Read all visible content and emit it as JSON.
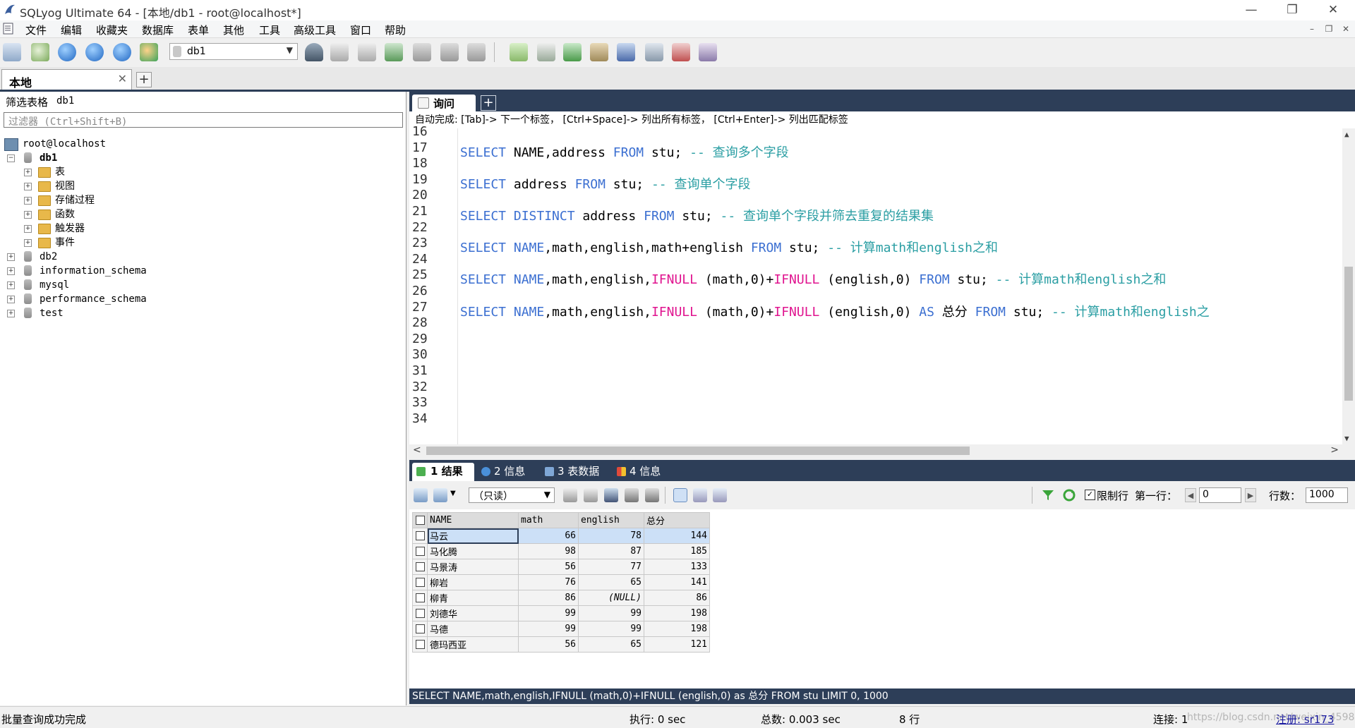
{
  "window": {
    "title": "SQLyog Ultimate 64 - [本地/db1 - root@localhost*]",
    "minimize": "—",
    "restore": "❐",
    "close": "✕"
  },
  "menu": {
    "items": [
      "文件",
      "编辑",
      "收藏夹",
      "数据库",
      "表单",
      "其他",
      "工具",
      "高级工具",
      "窗口",
      "帮助"
    ],
    "mdi_min": "–",
    "mdi_restore": "❐",
    "mdi_close": "✕"
  },
  "toolbar": {
    "db_select": "db1"
  },
  "connection_tab": {
    "label": "本地",
    "close": "✕",
    "add": "+"
  },
  "object_browser": {
    "filter_label": "筛选表格",
    "filter_db": "db1",
    "filter_placeholder": "过滤器 (Ctrl+Shift+B)",
    "server": "root@localhost",
    "db1": "db1",
    "db1_children": [
      "表",
      "视图",
      "存储过程",
      "函数",
      "触发器",
      "事件"
    ],
    "other_dbs": [
      "db2",
      "information_schema",
      "mysql",
      "performance_schema",
      "test"
    ]
  },
  "query_tab": {
    "label": "询问",
    "add": "+"
  },
  "autocomplete": "自动完成:  [Tab]-> 下一个标签， [Ctrl+Space]-> 列出所有标签， [Ctrl+Enter]-> 列出匹配标签",
  "editor": {
    "line_numbers": [
      "16",
      "17",
      "18",
      "19",
      "20",
      "21",
      "22",
      "23",
      "24",
      "25",
      "26",
      "27",
      "28",
      "29",
      "30",
      "31",
      "32",
      "33",
      "34"
    ],
    "lines": [
      [
        [
          "kw",
          "SELECT"
        ],
        [
          "t",
          " NAME"
        ],
        [
          "t",
          ",address "
        ],
        [
          "kw",
          "FROM"
        ],
        [
          "t",
          " stu; "
        ],
        [
          "cm",
          "-- 查询多个字段"
        ]
      ],
      [
        [
          "kw",
          "SELECT"
        ],
        [
          "t",
          " address "
        ],
        [
          "kw",
          "FROM"
        ],
        [
          "t",
          " stu; "
        ],
        [
          "cm",
          "-- 查询单个字段"
        ]
      ],
      [
        [
          "kw",
          "SELECT"
        ],
        [
          "t",
          " "
        ],
        [
          "kw",
          "DISTINCT"
        ],
        [
          "t",
          " address "
        ],
        [
          "kw",
          "FROM"
        ],
        [
          "t",
          " stu; "
        ],
        [
          "cm",
          "-- 查询单个字段并筛去重复的结果集"
        ]
      ],
      [
        [
          "kw",
          "SELECT"
        ],
        [
          "t",
          " "
        ],
        [
          "kw",
          "NAME"
        ],
        [
          "t",
          ",math,english,math+english "
        ],
        [
          "kw",
          "FROM"
        ],
        [
          "t",
          " stu; "
        ],
        [
          "cm",
          "-- 计算math和english之和"
        ]
      ],
      [
        [
          "kw",
          "SELECT"
        ],
        [
          "t",
          " "
        ],
        [
          "kw",
          "NAME"
        ],
        [
          "t",
          ",math,english,"
        ],
        [
          "fn",
          "IFNULL"
        ],
        [
          "t",
          " (math,0)+"
        ],
        [
          "fn",
          "IFNULL"
        ],
        [
          "t",
          " (english,0) "
        ],
        [
          "kw",
          "FROM"
        ],
        [
          "t",
          " stu; "
        ],
        [
          "cm",
          "-- 计算math和english之和"
        ]
      ],
      [
        [
          "kw",
          "SELECT"
        ],
        [
          "t",
          " "
        ],
        [
          "kw",
          "NAME"
        ],
        [
          "t",
          ",math,english,"
        ],
        [
          "fn",
          "IFNULL"
        ],
        [
          "t",
          " (math,0)+"
        ],
        [
          "fn",
          "IFNULL"
        ],
        [
          "t",
          " (english,0) "
        ],
        [
          "kw",
          "AS"
        ],
        [
          "t",
          " 总分 "
        ],
        [
          "kw",
          "FROM"
        ],
        [
          "t",
          " stu; "
        ],
        [
          "cm",
          "-- 计算math和english之"
        ]
      ]
    ]
  },
  "result_tabs": [
    {
      "label": "1 结果",
      "color": "#4caf50"
    },
    {
      "label": "2 信息",
      "color": "#4a90d9"
    },
    {
      "label": "3 表数据",
      "color": "#7fa7d6"
    },
    {
      "label": "4 信息",
      "color": "#e04a3a"
    }
  ],
  "result_toolbar": {
    "readonly": "（只读）",
    "limit_label": "限制行",
    "first_row_label": "第一行：",
    "first_row_value": "0",
    "rows_label": "行数：",
    "rows_value": "1000"
  },
  "grid": {
    "columns": [
      "NAME",
      "math",
      "english",
      "总分"
    ],
    "rows": [
      [
        "马云",
        "66",
        "78",
        "144"
      ],
      [
        "马化腾",
        "98",
        "87",
        "185"
      ],
      [
        "马景涛",
        "56",
        "77",
        "133"
      ],
      [
        "柳岩",
        "76",
        "65",
        "141"
      ],
      [
        "柳青",
        "86",
        "(NULL)",
        "86"
      ],
      [
        "刘德华",
        "99",
        "99",
        "198"
      ],
      [
        "马德",
        "99",
        "99",
        "198"
      ],
      [
        "德玛西亚",
        "56",
        "65",
        "121"
      ]
    ]
  },
  "sql_status": "SELECT NAME,math,english,IFNULL (math,0)+IFNULL (english,0) as 总分 FROM stu LIMIT 0, 1000",
  "statusbar": {
    "message": "批量查询成功完成",
    "exec": "执行: 0 sec",
    "total": "总数: 0.003 sec",
    "rows": "8 行",
    "connection": "连接: 1",
    "register": "注册: sr173",
    "watermark": "https://blog.csdn.net/weixin_45980980"
  }
}
